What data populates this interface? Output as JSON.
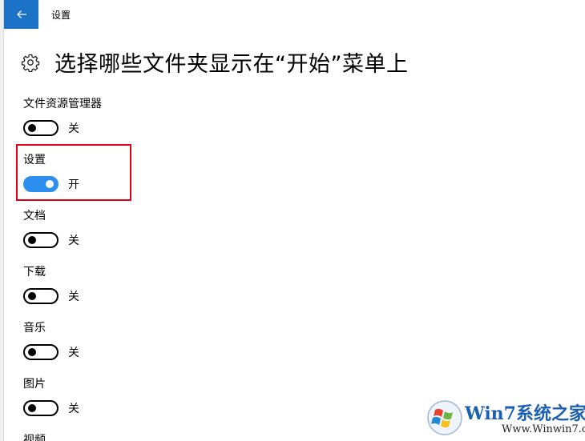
{
  "window": {
    "app_title": "设置",
    "back_icon": "arrow-left-icon"
  },
  "header": {
    "title": "选择哪些文件夹显示在“开始”菜单上",
    "icon": "gear-icon"
  },
  "settings": [
    {
      "label": "文件资源管理器",
      "state_label": "关",
      "on": false
    },
    {
      "label": "设置",
      "state_label": "开",
      "on": true
    },
    {
      "label": "文档",
      "state_label": "关",
      "on": false
    },
    {
      "label": "下载",
      "state_label": "关",
      "on": false
    },
    {
      "label": "音乐",
      "state_label": "关",
      "on": false
    },
    {
      "label": "图片",
      "state_label": "关",
      "on": false
    },
    {
      "label": "视频"
    }
  ],
  "watermark": {
    "name": "Win7系统之家",
    "url": "Www.Winwin7.com"
  },
  "colors": {
    "accent": "#1a73c7",
    "toggle_on": "#2d8ff0",
    "highlight": "#e0001a"
  }
}
